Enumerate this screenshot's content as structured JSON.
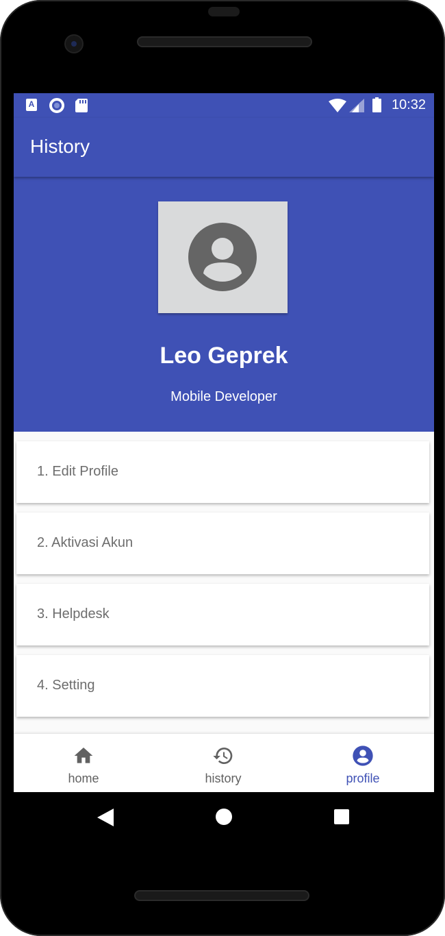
{
  "status_bar": {
    "time": "10:32",
    "left_icons": [
      "a-icon",
      "circle-icon",
      "sd-card-icon"
    ],
    "right_icons": [
      "wifi-icon",
      "signal-icon",
      "battery-icon"
    ]
  },
  "app_bar": {
    "title": "History"
  },
  "profile": {
    "name": "Leo Geprek",
    "role": "Mobile Developer",
    "avatar_icon": "account-circle-icon"
  },
  "menu": {
    "items": [
      {
        "label": "1. Edit Profile"
      },
      {
        "label": "2. Aktivasi Akun"
      },
      {
        "label": "3. Helpdesk"
      },
      {
        "label": "4. Setting"
      }
    ]
  },
  "bottom_nav": {
    "items": [
      {
        "label": "home",
        "icon": "home-icon",
        "active": false
      },
      {
        "label": "history",
        "icon": "history-icon",
        "active": false
      },
      {
        "label": "profile",
        "icon": "account-circle-icon",
        "active": true
      }
    ]
  },
  "colors": {
    "primary": "#3f51b5",
    "avatar_bg": "#d9dadb",
    "avatar_fg": "#656565",
    "menu_text": "#6d6d6d",
    "nav_inactive": "#616161"
  }
}
